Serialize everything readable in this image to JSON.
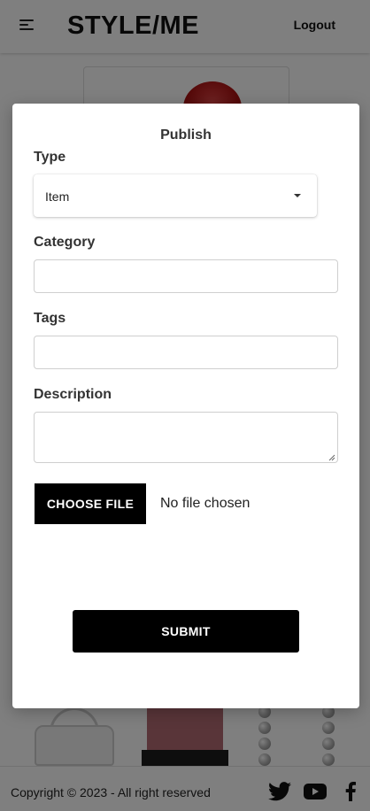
{
  "header": {
    "brand": "STYLE/ME",
    "logout_label": "Logout",
    "menu_icon": "menu-icon"
  },
  "modal": {
    "title": "Publish",
    "type": {
      "label": "Type",
      "selected": "Item"
    },
    "category": {
      "label": "Category",
      "value": ""
    },
    "tags": {
      "label": "Tags",
      "value": ""
    },
    "description": {
      "label": "Description",
      "value": ""
    },
    "file": {
      "button_label": "CHOOSE FILE",
      "status": "No file chosen"
    },
    "submit_label": "SUBMIT"
  },
  "footer": {
    "copyright": "Copyright © 2023 - All right reserved",
    "social_icons": [
      "twitter-icon",
      "youtube-icon",
      "facebook-icon"
    ]
  },
  "colors": {
    "primary_button": "#000000",
    "backdrop": "rgba(0,0,0,0.5)",
    "text": "#333333"
  }
}
